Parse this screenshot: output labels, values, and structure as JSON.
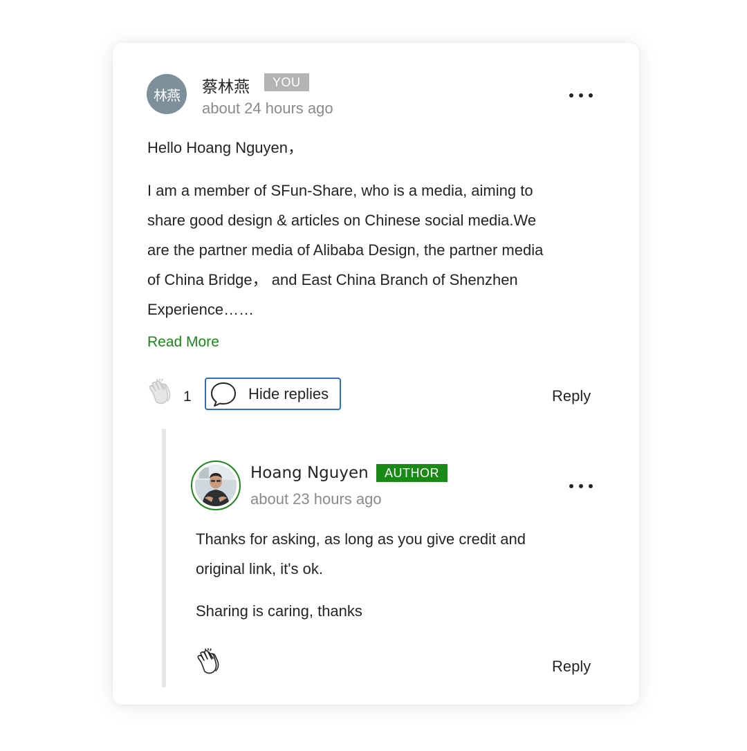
{
  "comment": {
    "avatar_text": "林燕",
    "author": "蔡林燕",
    "badge": "YOU",
    "timestamp": "about 24 hours ago",
    "greeting": "Hello Hoang Nguyen，",
    "body_lines": [
      "I am a member of SFun-Share, who is a media, aiming to",
      "share good design & articles on Chinese social media.We",
      "are the partner media of Alibaba Design, the partner media",
      "of China Bridge，  and East China Branch of Shenzhen",
      "Experience……"
    ],
    "read_more": "Read More",
    "clap_count": "1",
    "hide_replies": "Hide replies",
    "reply": "Reply"
  },
  "reply": {
    "author": "Hoang Nguyen",
    "badge": "AUTHOR",
    "timestamp": "about 23 hours ago",
    "body_lines": [
      "Thanks for asking, as long as you give credit and",
      "original link, it's ok."
    ],
    "body_line_2": "Sharing is caring, thanks",
    "reply": "Reply"
  },
  "colors": {
    "accent_green": "#1a8917",
    "focus_blue": "#2b6cc4",
    "you_badge": "#b3b3b3",
    "avatar_bg": "#7c8f9b"
  },
  "icons": {
    "more": "more-horizontal-icon",
    "clap": "clap-icon",
    "comment": "speech-bubble-icon"
  }
}
